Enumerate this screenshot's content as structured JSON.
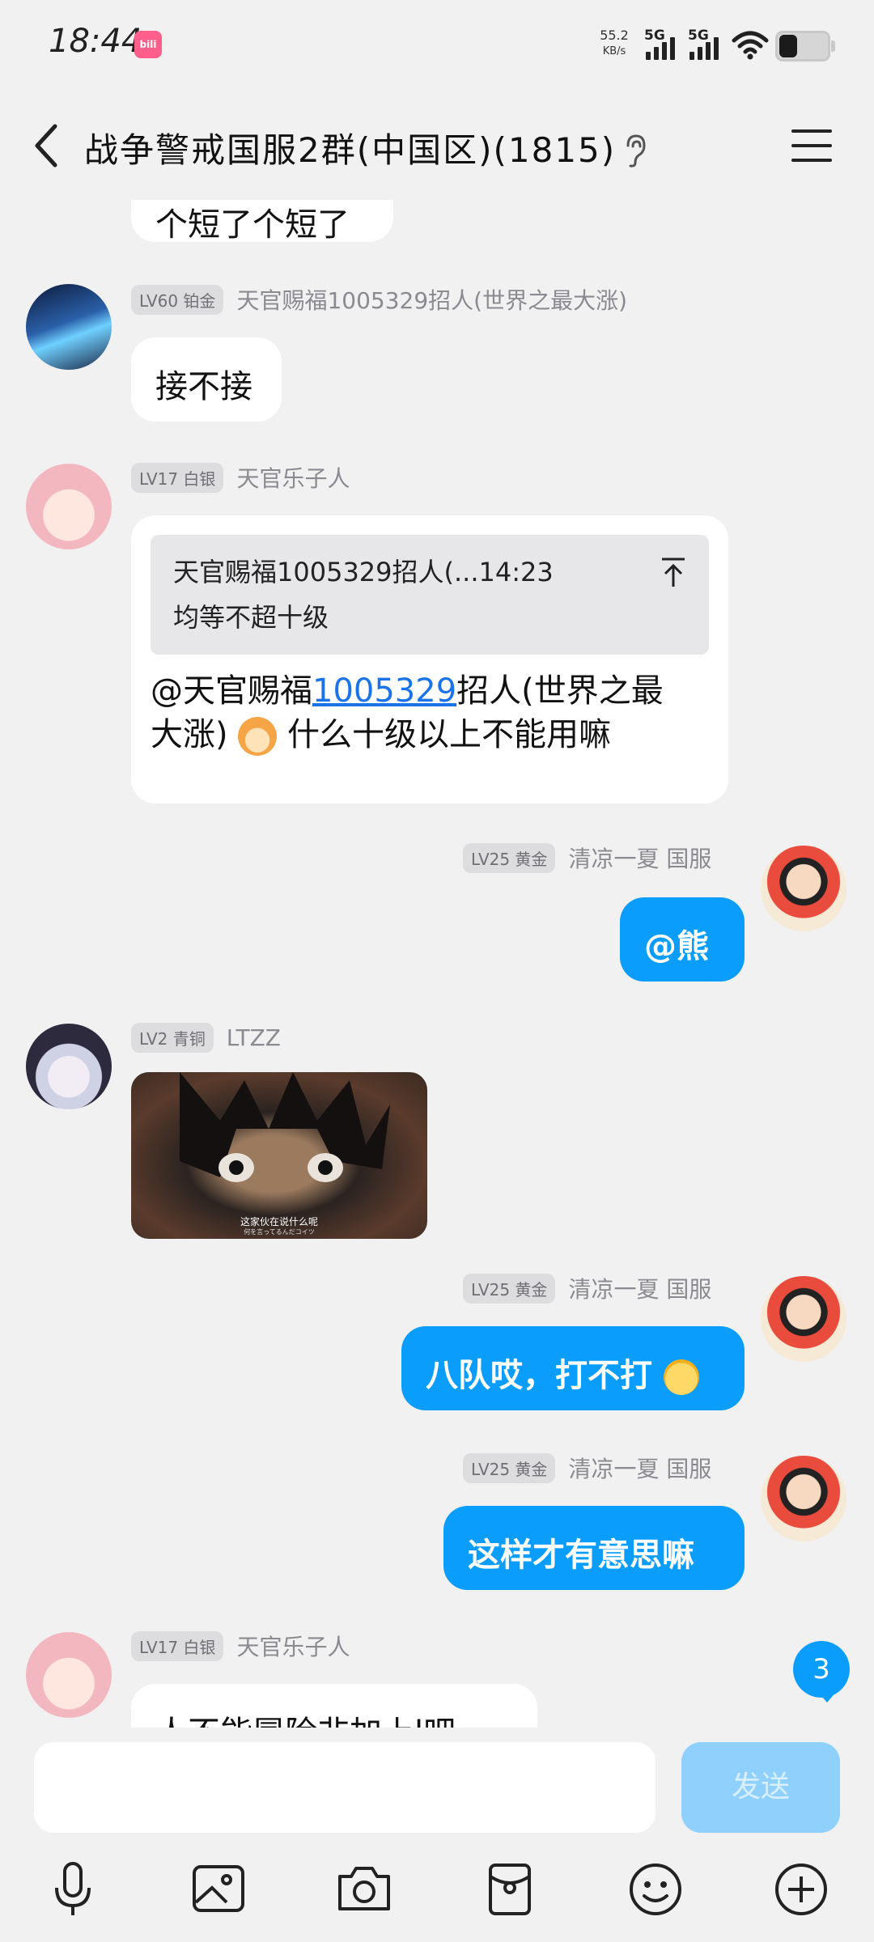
{
  "status": {
    "time": "18:44",
    "app_badge": "bili",
    "netspeed_value": "55.2",
    "netspeed_unit": "KB/s",
    "signal1": "5G",
    "signal2": "5G"
  },
  "header": {
    "title": "战争警戒国服2群(中国区)(1815)"
  },
  "messages": [
    {
      "text": "个短了个短了"
    },
    {
      "level": "LV60 铂金",
      "nick": "天官赐福1005329招人(世界之最大涨)",
      "text": "接不接"
    },
    {
      "level": "LV17 白银",
      "nick": "天官乐子人",
      "quote_line1": "天官赐福1005329招人(...14:23",
      "quote_line2": "均等不超十级",
      "reply_prefix": "@天官赐福",
      "reply_link": "1005329",
      "reply_mid": "招人(世界之最",
      "reply_line2_a": "大涨)",
      "reply_line2_b": "什么十级以上不能用嘛"
    },
    {
      "level": "LV25 黄金",
      "nick": "清凉一夏 国服",
      "text": "@熊"
    },
    {
      "level": "LV2 青铜",
      "nick": "LTZZ",
      "image_caption": "这家伙在说什么呢",
      "image_subcaption": "何を言ってるんだコイツ"
    },
    {
      "level": "LV25 黄金",
      "nick": "清凉一夏 国服",
      "text": "八队哎，打不打"
    },
    {
      "level": "LV25 黄金",
      "nick": "清凉一夏 国服",
      "text": "这样才有意思嘛"
    },
    {
      "level": "LV17 白银",
      "nick": "天官乐子人",
      "text": "人不能冒险非加上l吧"
    }
  ],
  "unread_count": "3",
  "composer": {
    "placeholder": "",
    "send_label": "发送"
  },
  "toolbar": {
    "icons": [
      "microphone-icon",
      "image-icon",
      "camera-icon",
      "red-packet-icon",
      "emoji-icon",
      "plus-icon"
    ]
  },
  "colors": {
    "accent": "#0a9dfc",
    "background": "#f1f1f2"
  }
}
